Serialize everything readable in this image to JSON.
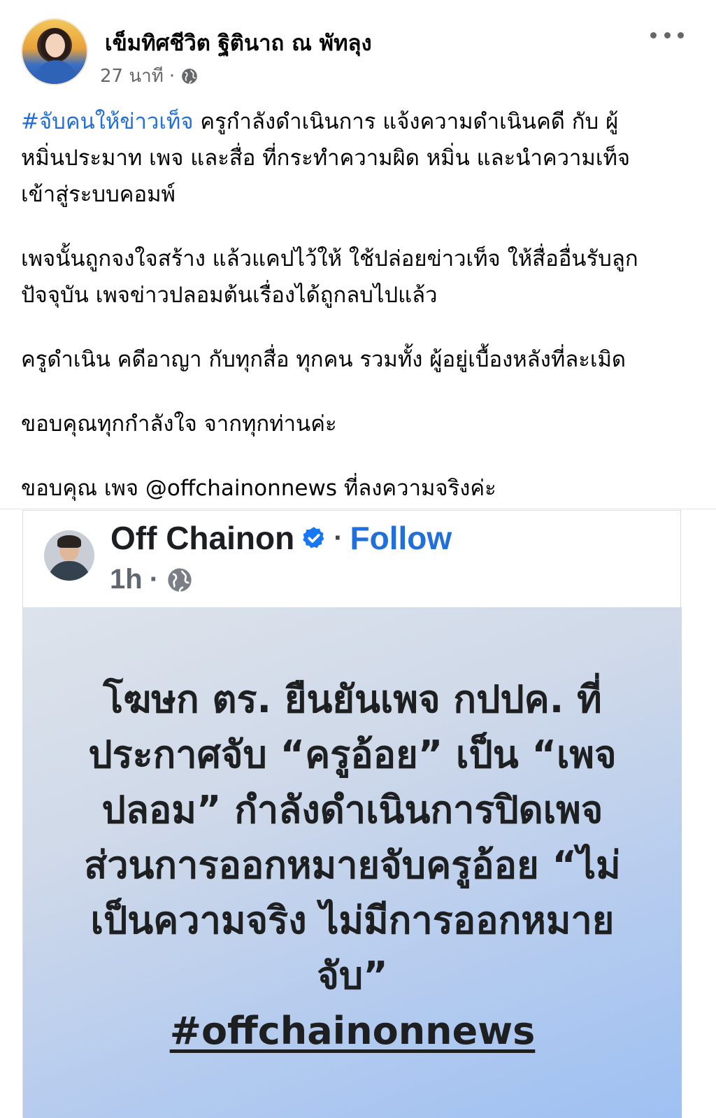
{
  "post": {
    "author": "เข็มทิศชีวิต ฐิตินาถ ณ พัทลุง",
    "time": "27 นาที",
    "separator": "·",
    "lines": [
      {
        "hashtag": "#จับคนให้ข่าวเท็จ",
        "text": " ครูกำลังดำเนินการ แจ้งความดำเนินคดี กับ ผู้"
      },
      {
        "text": "หมิ่นประมาท เพจ และสื่อ ที่กระทำความผิด หมิ่น และนำความเท็จ"
      },
      {
        "text": "เข้าสู่ระบบคอมพ์"
      },
      {
        "text": "เพจนั้นถูกจงใจสร้าง แล้วแคปไว้ให้ ใช้ปล่อยข่าวเท็จ ให้สื่ออื่นรับลูก"
      },
      {
        "text": "ปัจจุบัน เพจข่าวปลอมต้นเรื่องได้ถูกลบไปแล้ว"
      },
      {
        "text": "ครูดำเนิน คดีอาญา กับทุกสื่อ ทุกคน รวมทั้ง ผู้อยู่เบื้องหลังที่ละเมิด"
      },
      {
        "text": "ขอบคุณทุกกำลังใจ จากทุกท่านค่ะ"
      },
      {
        "text": "ขอบคุณ เพจ @offchainonnews ที่ลงความจริงค่ะ"
      }
    ]
  },
  "shared": {
    "name": "Off Chainon",
    "separator": "·",
    "follow": "Follow",
    "time": "1h",
    "headline_lines": [
      "โฆษก ตร. ยืนยันเพจ กปปค. ที่",
      "ประกาศจับ “ครูอ้อย” เป็น “เพจ",
      "ปลอม” กำลังดำเนินการปิดเพจ",
      "ส่วนการออกหมายจับครูอ้อย “ไม่",
      "เป็นความจริง ไม่มีการออกหมาย",
      "จับ”"
    ],
    "hashtag": "#offchainonnews"
  },
  "icons": {
    "more": "more-options-icon",
    "privacy": "globe-icon",
    "verified": "verified-badge-icon"
  },
  "colors": {
    "link": "#216fdb",
    "secondary_text": "#65676b",
    "verified": "#1877f2"
  }
}
